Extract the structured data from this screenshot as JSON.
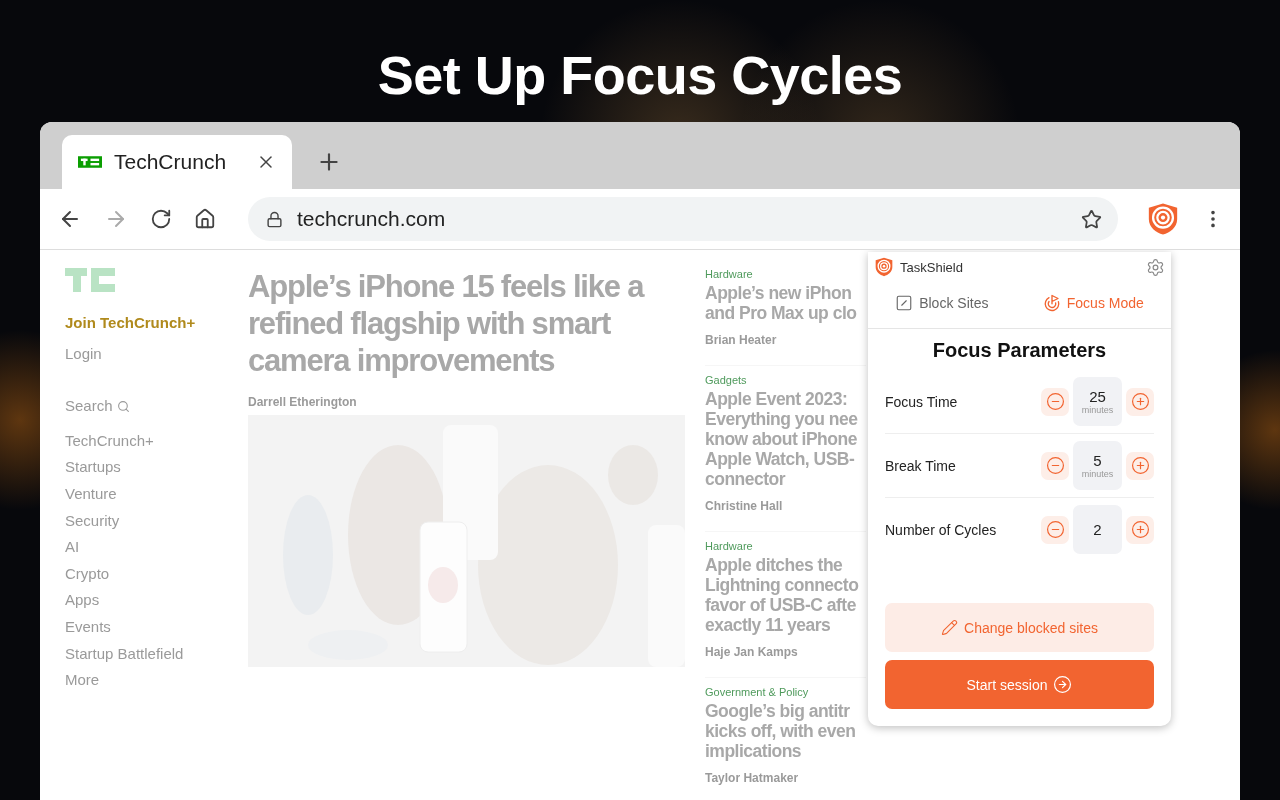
{
  "headline": "Set Up Focus Cycles",
  "browser": {
    "tabs": [
      {
        "title": "TechCrunch",
        "selected": true
      }
    ],
    "url": "techcrunch.com",
    "forward_disabled": true
  },
  "site": {
    "join": "Join TechCrunch+",
    "login": "Login",
    "search": "Search",
    "nav": [
      "TechCrunch+",
      "Startups",
      "Venture",
      "Security",
      "AI",
      "Crypto",
      "Apps",
      "Events",
      "Startup Battlefield",
      "More"
    ],
    "lead": {
      "title": "Apple’s iPhone 15 feels like a refined flagship with smart camera improvements",
      "author": "Darrell Etherington"
    },
    "stories": [
      {
        "category": "Hardware",
        "title_lines": [
          "Apple’s new iPhon",
          "and Pro Max up clo"
        ],
        "author": "Brian Heater"
      },
      {
        "category": "Gadgets",
        "title_lines": [
          "Apple Event 2023:",
          "Everything you nee",
          "know about iPhone",
          "Apple Watch, USB-",
          "connector"
        ],
        "author": "Christine Hall"
      },
      {
        "category": "Hardware",
        "title_lines": [
          "Apple ditches the",
          "Lightning connecto",
          "favor of USB-C afte",
          "exactly 11 years"
        ],
        "author": "Haje Jan Kamps"
      },
      {
        "category": "Government & Policy",
        "title_lines": [
          "Google’s big antitr",
          "kicks off, with even",
          "implications"
        ],
        "author": "Taylor Hatmaker"
      }
    ]
  },
  "extension": {
    "name": "TaskShield",
    "tabs": [
      {
        "label": "Block Sites",
        "selected": false
      },
      {
        "label": "Focus Mode",
        "selected": true
      }
    ],
    "heading": "Focus Parameters",
    "parameters": [
      {
        "label": "Focus Time",
        "value": "25",
        "unit": "minutes"
      },
      {
        "label": "Break Time",
        "value": "5",
        "unit": "minutes"
      },
      {
        "label": "Number of Cycles",
        "value": "2"
      }
    ],
    "secondary_button": "Change blocked sites",
    "primary_button": "Start session"
  }
}
